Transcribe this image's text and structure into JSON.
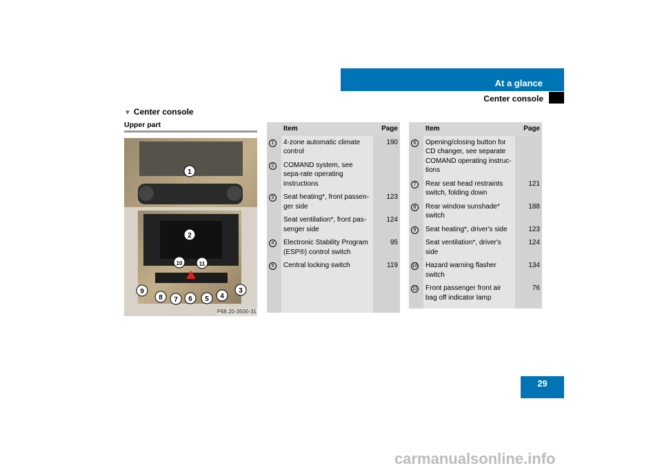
{
  "header": {
    "chapter": "At a glance",
    "section": "Center console",
    "accent": "#0074b4"
  },
  "section_title": "Center console",
  "subsection": "Upper part",
  "figure": {
    "caption": "P68.20-3500-31",
    "callouts": [
      "1",
      "2",
      "3",
      "4",
      "5",
      "6",
      "7",
      "8",
      "9",
      "10",
      "11"
    ]
  },
  "table_left": {
    "headers": {
      "item": "Item",
      "page": "Page"
    },
    "rows": [
      {
        "num": "1",
        "item": "4-zone automatic climate control",
        "page": "190"
      },
      {
        "num": "2",
        "item": "COMAND system, see sepa-rate operating instructions",
        "page": ""
      },
      {
        "num": "3",
        "item": "Seat heating*, front passen-ger side",
        "page": "123"
      },
      {
        "num": "",
        "item": "Seat ventilation*, front pas-senger side",
        "page": "124"
      },
      {
        "num": "4",
        "item": "Electronic Stability Program (ESP®) control switch",
        "page": "95"
      },
      {
        "num": "5",
        "item": "Central locking switch",
        "page": "119"
      }
    ]
  },
  "table_right": {
    "headers": {
      "item": "Item",
      "page": "Page"
    },
    "rows": [
      {
        "num": "6",
        "item": "Opening/closing button for CD changer, see separate COMAND operating instruc-tions",
        "page": ""
      },
      {
        "num": "7",
        "item": "Rear seat head restraints switch, folding down",
        "page": "121"
      },
      {
        "num": "8",
        "item": "Rear window sunshade* switch",
        "page": "188"
      },
      {
        "num": "9",
        "item": "Seat heating*, driver's side",
        "page": "123"
      },
      {
        "num": "",
        "item": "Seat ventilation*, driver's side",
        "page": "124"
      },
      {
        "num": "10",
        "item": "Hazard warning flasher switch",
        "page": "134"
      },
      {
        "num": "11",
        "item": "Front passenger front air bag off indicator lamp",
        "page": "76"
      }
    ]
  },
  "page_number": "29",
  "watermark": "carmanualsonline.info"
}
